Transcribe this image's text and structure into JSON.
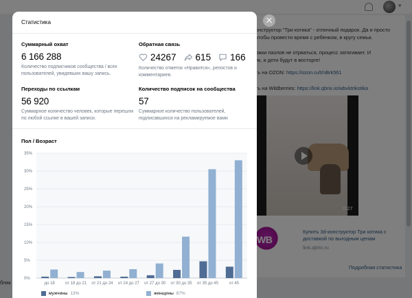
{
  "background": {
    "post_lines": [
      "онструктор \"Три котика\" - отличный подарок. Да и просто",
      "чтобы провести время с ребенком, в кругу семьи.",
      "",
      "ожки пазлов не отрваться, процесс затягивает. И",
      "ик, и дети будут в восторге!"
    ],
    "ozon_prefix": "ть на OZON: ",
    "ozon_link": "https://ozon.ru/t/nBrk561",
    "wb_prefix": "ть на Wildberries: ",
    "wb_link": "https://link.qbrix.io/wbvktrikotika",
    "video_time": "0:27",
    "ad_logo": "WB",
    "ad_title": "Купить 3d-конструктор Три котика с доставкой по выгодным ценам",
    "ad_url": "link.qbrix.ru",
    "detail_link": "Подробная статистика",
    "left_fragment": "блик"
  },
  "modal": {
    "title": "Статистика",
    "reach": {
      "label": "Суммарный охват",
      "value": "6 166 288",
      "desc": "Количество подписчиков сообщества / всех пользователей, увидевших вашу запись."
    },
    "feedback": {
      "label": "Обратная связь",
      "likes": "24267",
      "reposts": "615",
      "comments": "166",
      "desc": "Количество отметок «Нравится», репостов и комментариев."
    },
    "clicks": {
      "label": "Переходы по ссылкам",
      "value": "56 920",
      "desc": "Суммарное количество человек, которые перешли по любой ссылке в вашей записи."
    },
    "subs": {
      "label": "Количество подписок на сообщества",
      "value": "57",
      "desc": "Суммарное количество пользователей, подписавшихся на рекламируемое вами"
    },
    "chart_title": "Пол / Возраст"
  },
  "icons": {
    "close": "close-icon",
    "likes": "heart-icon",
    "reposts": "share-arrow-icon",
    "comments": "comment-icon",
    "notifications": "bell-icon"
  },
  "colors": {
    "male": "#4f6c95",
    "female": "#91b0d2",
    "link": "#2a5885"
  },
  "chart_data": {
    "type": "bar",
    "categories": [
      "до 18",
      "от 18 до 21",
      "от 21 до 24",
      "от 24 до 27",
      "от 27 до 30",
      "от 30 до 35",
      "от 35 до 45",
      "от 45"
    ],
    "series": [
      {
        "name": "мужчины",
        "values": [
          0.4,
          0.3,
          0.5,
          0.4,
          0.8,
          2.3,
          4.7,
          3.2
        ]
      },
      {
        "name": "женщины",
        "values": [
          2.4,
          1.7,
          2.1,
          2.5,
          4.1,
          11.6,
          30.5,
          33.0
        ]
      }
    ],
    "yticks": [
      "0%",
      "5%",
      "10%",
      "15%",
      "20%",
      "25%",
      "30%",
      "35%"
    ],
    "ylim": [
      0,
      35
    ],
    "grid": true,
    "legend": [
      {
        "name": "мужчины",
        "pct": "13%"
      },
      {
        "name": "женщины",
        "pct": "87%"
      }
    ],
    "legend_position": "bottom"
  }
}
